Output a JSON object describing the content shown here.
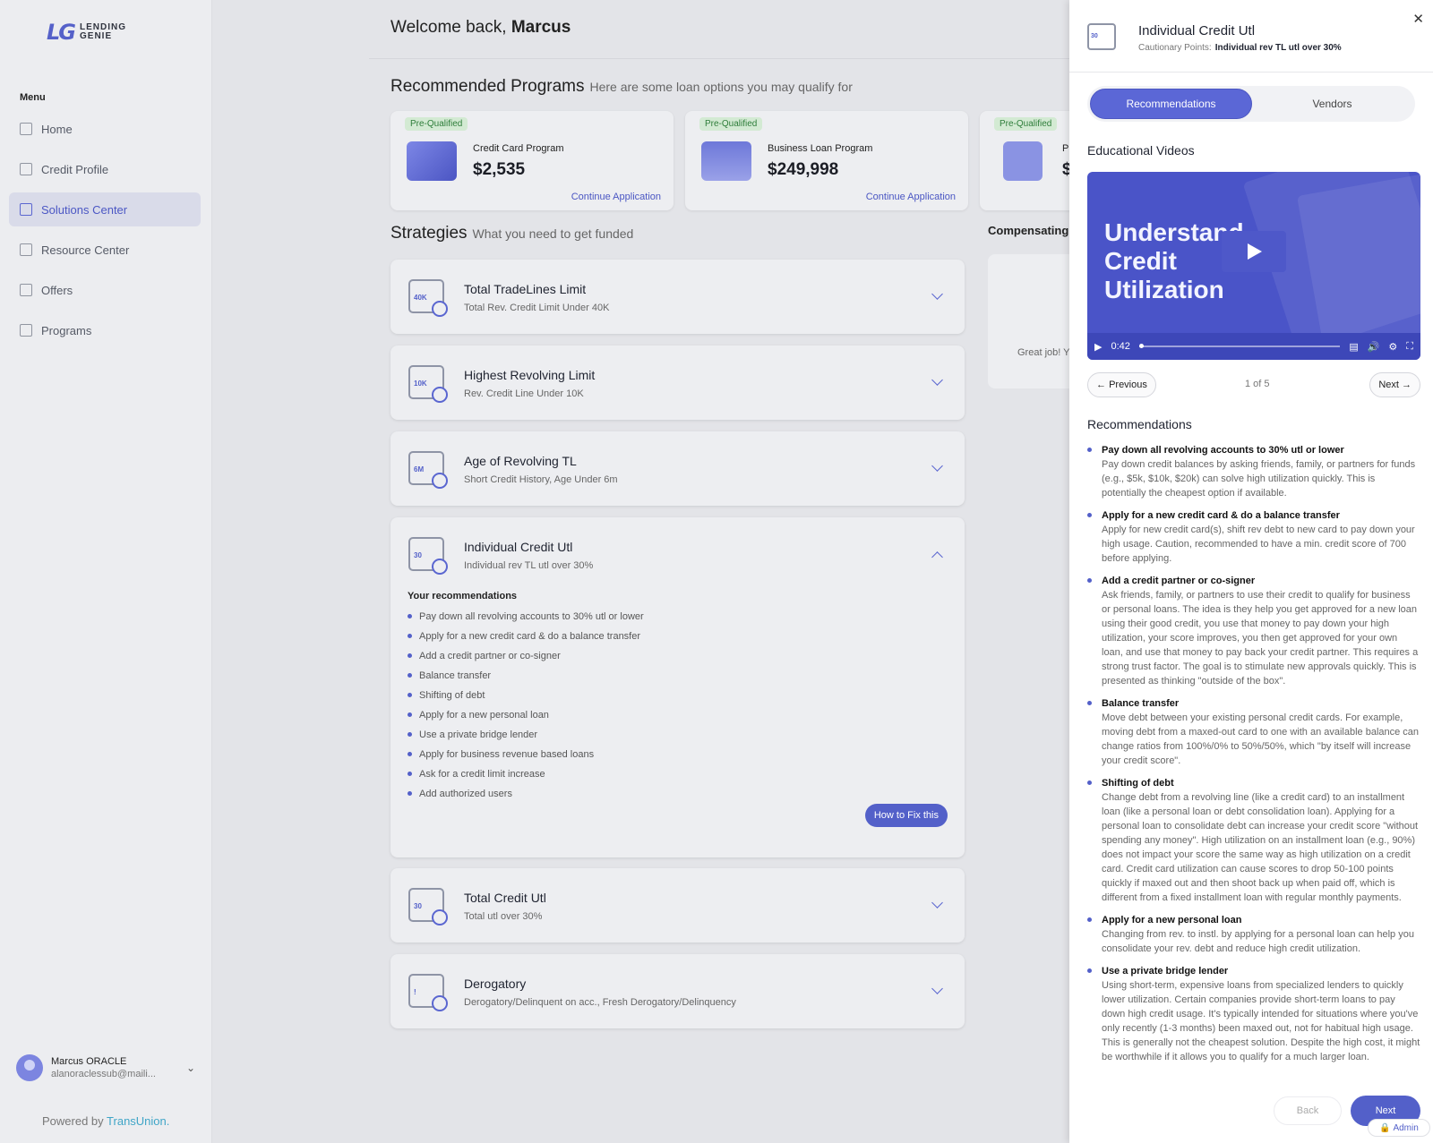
{
  "brand": {
    "mark": "LG",
    "line1": "LENDING",
    "line2": "GENIE"
  },
  "sidebar": {
    "menu_title": "Menu",
    "items": [
      {
        "label": "Home"
      },
      {
        "label": "Credit Profile"
      },
      {
        "label": "Solutions Center"
      },
      {
        "label": "Resource Center"
      },
      {
        "label": "Offers"
      },
      {
        "label": "Programs"
      }
    ],
    "user": {
      "name": "Marcus ORACLE",
      "email": "alanoraclessub@maili..."
    },
    "powered_prefix": "Powered by",
    "powered_brand": "TransUnion."
  },
  "main": {
    "welcome_prefix": "Welcome back,",
    "welcome_name": "Marcus",
    "programs_title": "Recommended Programs",
    "programs_sub": "Here are some loan options you may qualify for",
    "programs": [
      {
        "badge": "Pre-Qualified",
        "name": "Credit Card Program",
        "amount": "$2,535",
        "link": "Continue Application"
      },
      {
        "badge": "Pre-Qualified",
        "name": "Business Loan Program",
        "amount": "$249,998",
        "link": "Continue Application"
      },
      {
        "badge": "Pre-Qualified",
        "name": "P",
        "amount": "$",
        "link": ""
      }
    ],
    "strategies_title": "Strategies",
    "strategies_sub": "What you need to get funded",
    "strategies": [
      {
        "icon": "40K",
        "title": "Total TradeLines Limit",
        "sub": "Total Rev. Credit Limit Under 40K"
      },
      {
        "icon": "10K",
        "title": "Highest Revolving Limit",
        "sub": "Rev. Credit Line Under 10K"
      },
      {
        "icon": "6M",
        "title": "Age of Revolving TL",
        "sub": "Short Credit History, Age Under 6m"
      },
      {
        "icon": "30",
        "title": "Individual Credit Utl",
        "sub": "Individual rev TL utl over 30%"
      },
      {
        "icon": "30",
        "title": "Total Credit Utl",
        "sub": "Total utl over 30%"
      },
      {
        "icon": "!",
        "title": "Derogatory",
        "sub": "Derogatory/Delinquent on acc., Fresh Derogatory/Delinquency"
      }
    ],
    "your_recs_title": "Your recommendations",
    "your_recs": [
      "Pay down all revolving accounts to 30% utl or lower",
      "Apply for a new credit card & do a balance transfer",
      "Add a credit partner or co-signer",
      "Balance transfer",
      "Shifting of debt",
      "Apply for a new personal loan",
      "Use a private bridge lender",
      "Apply for business revenue based loans",
      "Ask for a credit limit increase",
      "Add authorized users"
    ],
    "fix_button": "How to Fix this",
    "compensating_title": "Compensating",
    "compensating_text": "Great job! Y"
  },
  "panel": {
    "icon_label": "30",
    "title": "Individual Credit Utl",
    "cp_label": "Cautionary Points:",
    "cp_value": "Individual rev TL utl over 30%",
    "tabs": [
      {
        "label": "Recommendations"
      },
      {
        "label": "Vendors"
      }
    ],
    "edu_title": "Educational Videos",
    "video": {
      "line1": "Understand",
      "line2": "Credit",
      "line3": "Utilization",
      "time": "0:42",
      "progress": 0.0
    },
    "prev": "Previous",
    "next": "Next",
    "page": "1 of 5",
    "recs_title": "Recommendations",
    "recs": [
      {
        "h": "Pay down all revolving accounts to 30% utl or lower",
        "t": "Pay down credit balances by asking friends, family, or partners for funds (e.g., $5k, $10k, $20k) can solve high utilization quickly. This is potentially the cheapest option if available."
      },
      {
        "h": "Apply for a new credit card & do a balance transfer",
        "t": "Apply for new credit card(s), shift rev debt to new card to pay down your high usage. Caution, recommended to have a min. credit score of 700 before applying."
      },
      {
        "h": "Add a credit partner or co-signer",
        "t": "Ask friends, family, or partners to use their credit to qualify for business or personal loans. The idea is they help you get approved for a new loan using their good credit, you use that money to pay down your high utilization, your score improves, you then get approved for your own loan, and use that money to pay back your credit partner. This requires a strong trust factor. The goal is to stimulate new approvals quickly. This is presented as thinking \"outside of the box\"."
      },
      {
        "h": "Balance transfer",
        "t": "Move debt between your existing personal credit cards. For example, moving debt from a maxed-out card to one with an available balance can change ratios from 100%/0% to 50%/50%, which \"by itself will increase your credit score\"."
      },
      {
        "h": "Shifting of debt",
        "t": "Change debt from a revolving line (like a credit card) to an installment loan (like a personal loan or debt consolidation loan). Applying for a personal loan to consolidate debt can increase your credit score \"without spending any money\". High utilization on an installment loan (e.g., 90%) does not impact your score the same way as high utilization on a credit card. Credit card utilization can cause scores to drop 50-100 points quickly if maxed out and then shoot back up when paid off, which is different from a fixed installment loan with regular monthly payments."
      },
      {
        "h": "Apply for a new personal loan",
        "t": "Changing from rev. to instl. by applying for a personal loan can help you consolidate your rev. debt and reduce high credit utilization."
      },
      {
        "h": "Use a private bridge lender",
        "t": "Using short-term, expensive loans from specialized lenders to quickly lower utilization. Certain companies provide short-term loans to pay down high credit usage. It's typically intended for situations where you've only recently (1-3 months) been maxed out, not for habitual high usage. This is generally not the cheapest solution. Despite the high cost, it might be worthwhile if it allows you to qualify for a much larger loan."
      }
    ],
    "back": "Back",
    "next_main": "Next",
    "admin": "Admin"
  }
}
